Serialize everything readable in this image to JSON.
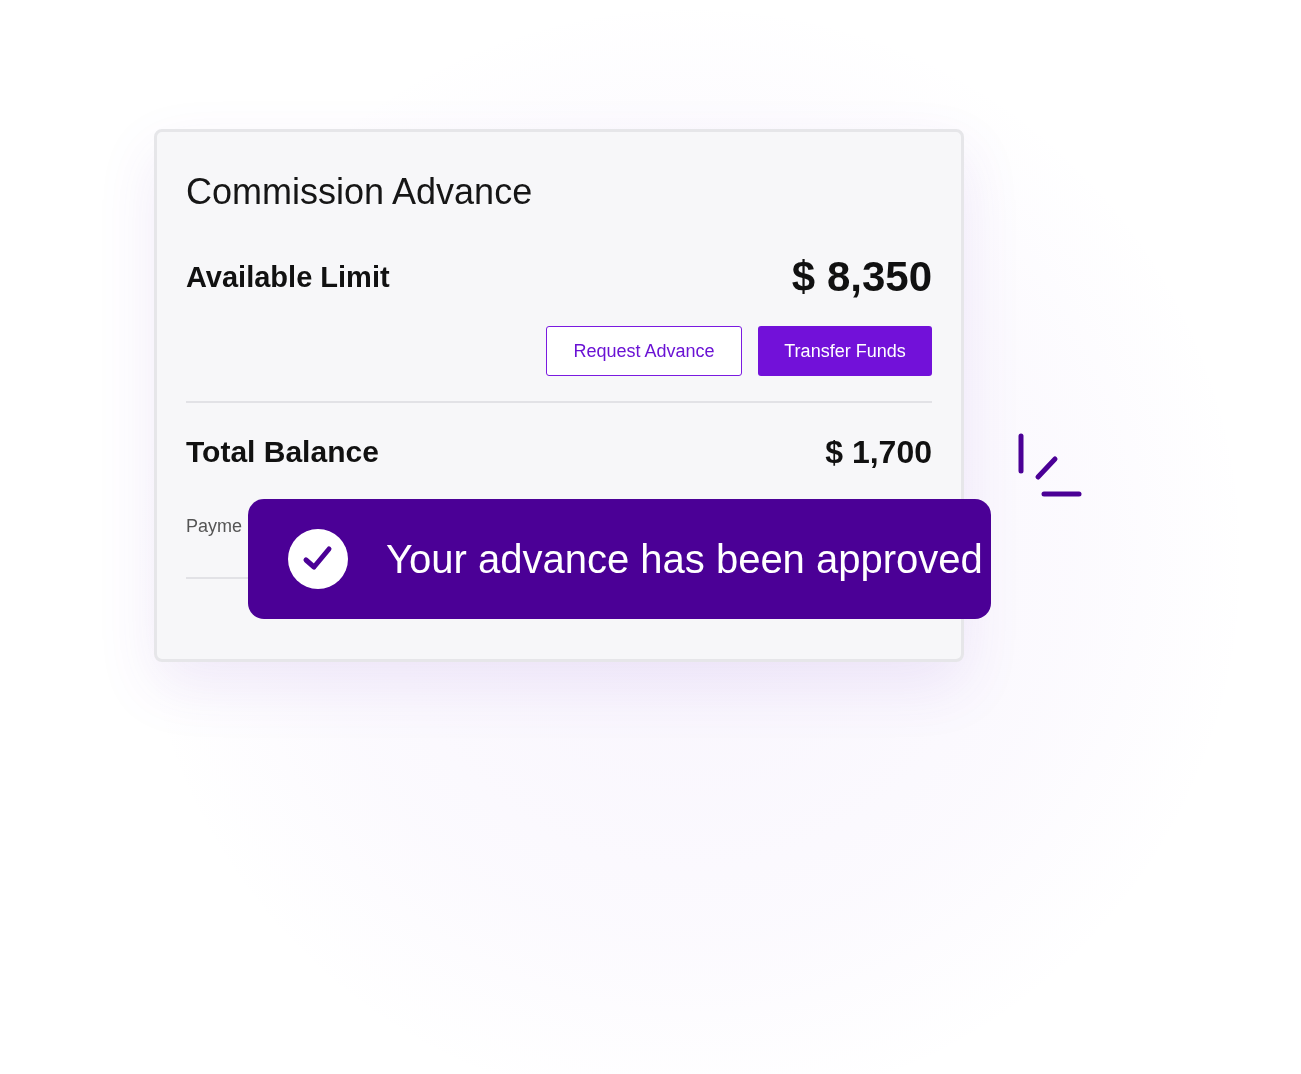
{
  "card": {
    "title": "Commission Advance",
    "rows": [
      {
        "kind": "limit",
        "label": "Available Limit",
        "amount": "$ 8,350",
        "actions": [
          {
            "kind": "outline",
            "label": "Request Advance"
          },
          {
            "kind": "primary",
            "label": "Transfer Funds"
          }
        ]
      },
      {
        "kind": "balance",
        "label": "Total Balance",
        "amount": "$ 1,700",
        "note": "Payme"
      }
    ]
  },
  "toast": {
    "message": "Your advance has been approved"
  }
}
